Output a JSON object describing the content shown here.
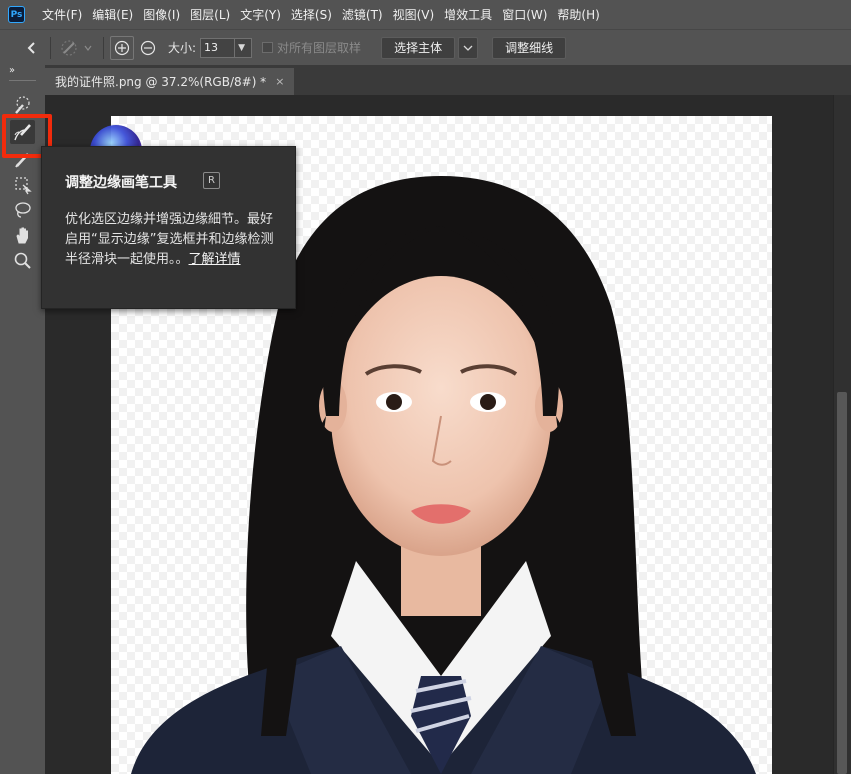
{
  "app": {
    "logo_text": "Ps"
  },
  "menu": [
    "文件(F)",
    "编辑(E)",
    "图像(I)",
    "图层(L)",
    "文字(Y)",
    "选择(S)",
    "滤镜(T)",
    "视图(V)",
    "增效工具",
    "窗口(W)",
    "帮助(H)"
  ],
  "options": {
    "size_label": "大小:",
    "size_value": "13",
    "sample_all_layers": "对所有图层取样",
    "select_subject": "选择主体",
    "refine_hair": "调整细线"
  },
  "document": {
    "tab_title": "我的证件照.png @ 37.2%(RGB/8#) *",
    "close_glyph": "×"
  },
  "toolbar": {
    "collapse_glyph": "››"
  },
  "tooltip": {
    "title": "调整边缘画笔工具",
    "shortcut": "R",
    "body": "优化选区边缘并增强边缘細节。最好启用“显示边缘”复选框并和边缘检测半径滑块一起使用。。",
    "link": "了解详情"
  },
  "colors": {
    "highlight": "#f22b0c",
    "ps_accent": "#31a8ff"
  }
}
